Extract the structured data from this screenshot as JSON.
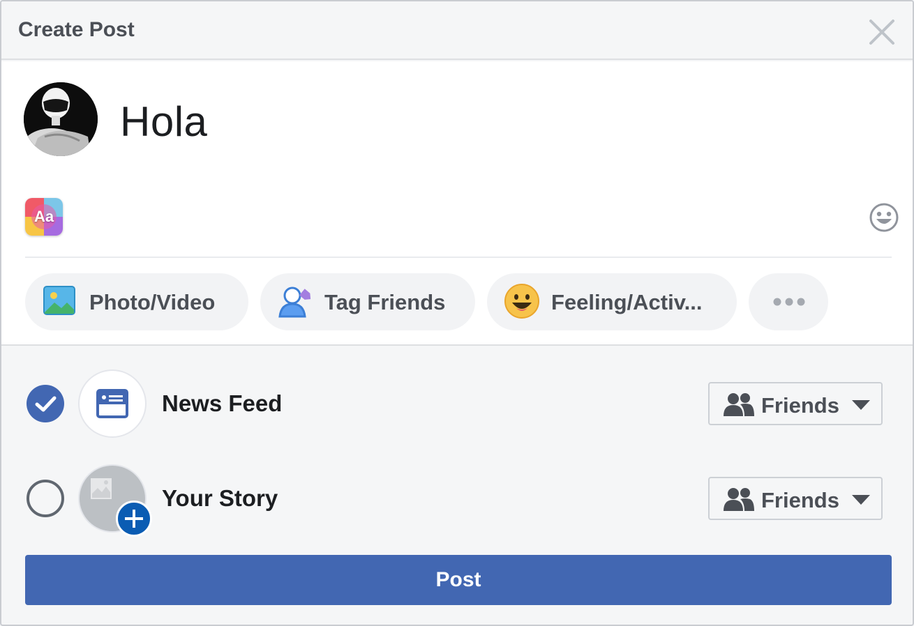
{
  "dialog": {
    "title": "Create Post",
    "close_icon": "close-icon"
  },
  "composer": {
    "post_text": "Hola",
    "avatar_icon": "avatar",
    "text_format_label": "Aa",
    "emoji_icon": "smiley-icon"
  },
  "actions": [
    {
      "label": "Photo/Video",
      "icon": "photo-icon"
    },
    {
      "label": "Tag Friends",
      "icon": "tag-friends-icon"
    },
    {
      "label": "Feeling/Activ...",
      "icon": "feeling-emoji-icon"
    },
    {
      "label": "",
      "icon": "more-dots-icon"
    }
  ],
  "destinations": [
    {
      "label": "News Feed",
      "checked": true,
      "icon": "news-feed-icon",
      "audience": "Friends"
    },
    {
      "label": "Your Story",
      "checked": false,
      "icon": "story-thumbnail-icon",
      "audience": "Friends"
    }
  ],
  "post_button": {
    "label": "Post"
  },
  "colors": {
    "brand_blue": "#4267b2",
    "badge_blue": "#0a5cb3",
    "header_text": "#4b4f56",
    "background": "#f5f6f7"
  }
}
